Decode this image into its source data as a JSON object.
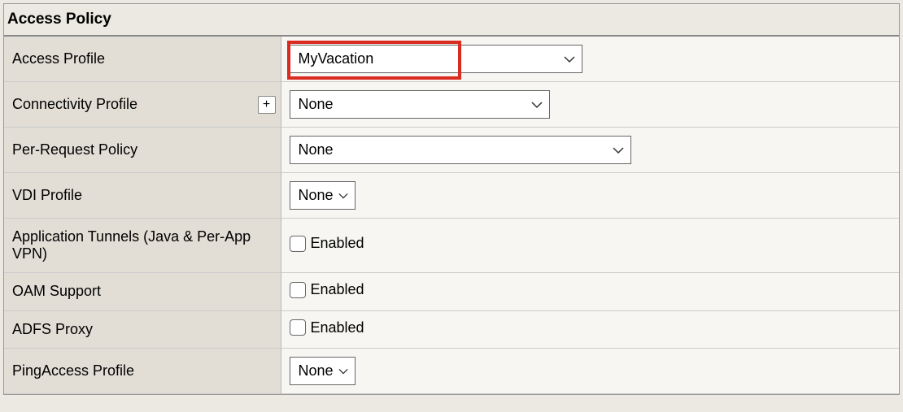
{
  "section_title": "Access Policy",
  "rows": {
    "access_profile": {
      "label": "Access Profile",
      "value": "MyVacation"
    },
    "connectivity_profile": {
      "label": "Connectivity Profile",
      "value": "None",
      "plus": "+"
    },
    "per_request_policy": {
      "label": "Per-Request Policy",
      "value": "None"
    },
    "vdi_profile": {
      "label": "VDI Profile",
      "value": "None"
    },
    "app_tunnels": {
      "label": "Application Tunnels (Java & Per-App VPN)",
      "value": "Enabled"
    },
    "oam_support": {
      "label": "OAM Support",
      "value": "Enabled"
    },
    "adfs_proxy": {
      "label": "ADFS Proxy",
      "value": "Enabled"
    },
    "pingaccess_profile": {
      "label": "PingAccess Profile",
      "value": "None"
    }
  }
}
